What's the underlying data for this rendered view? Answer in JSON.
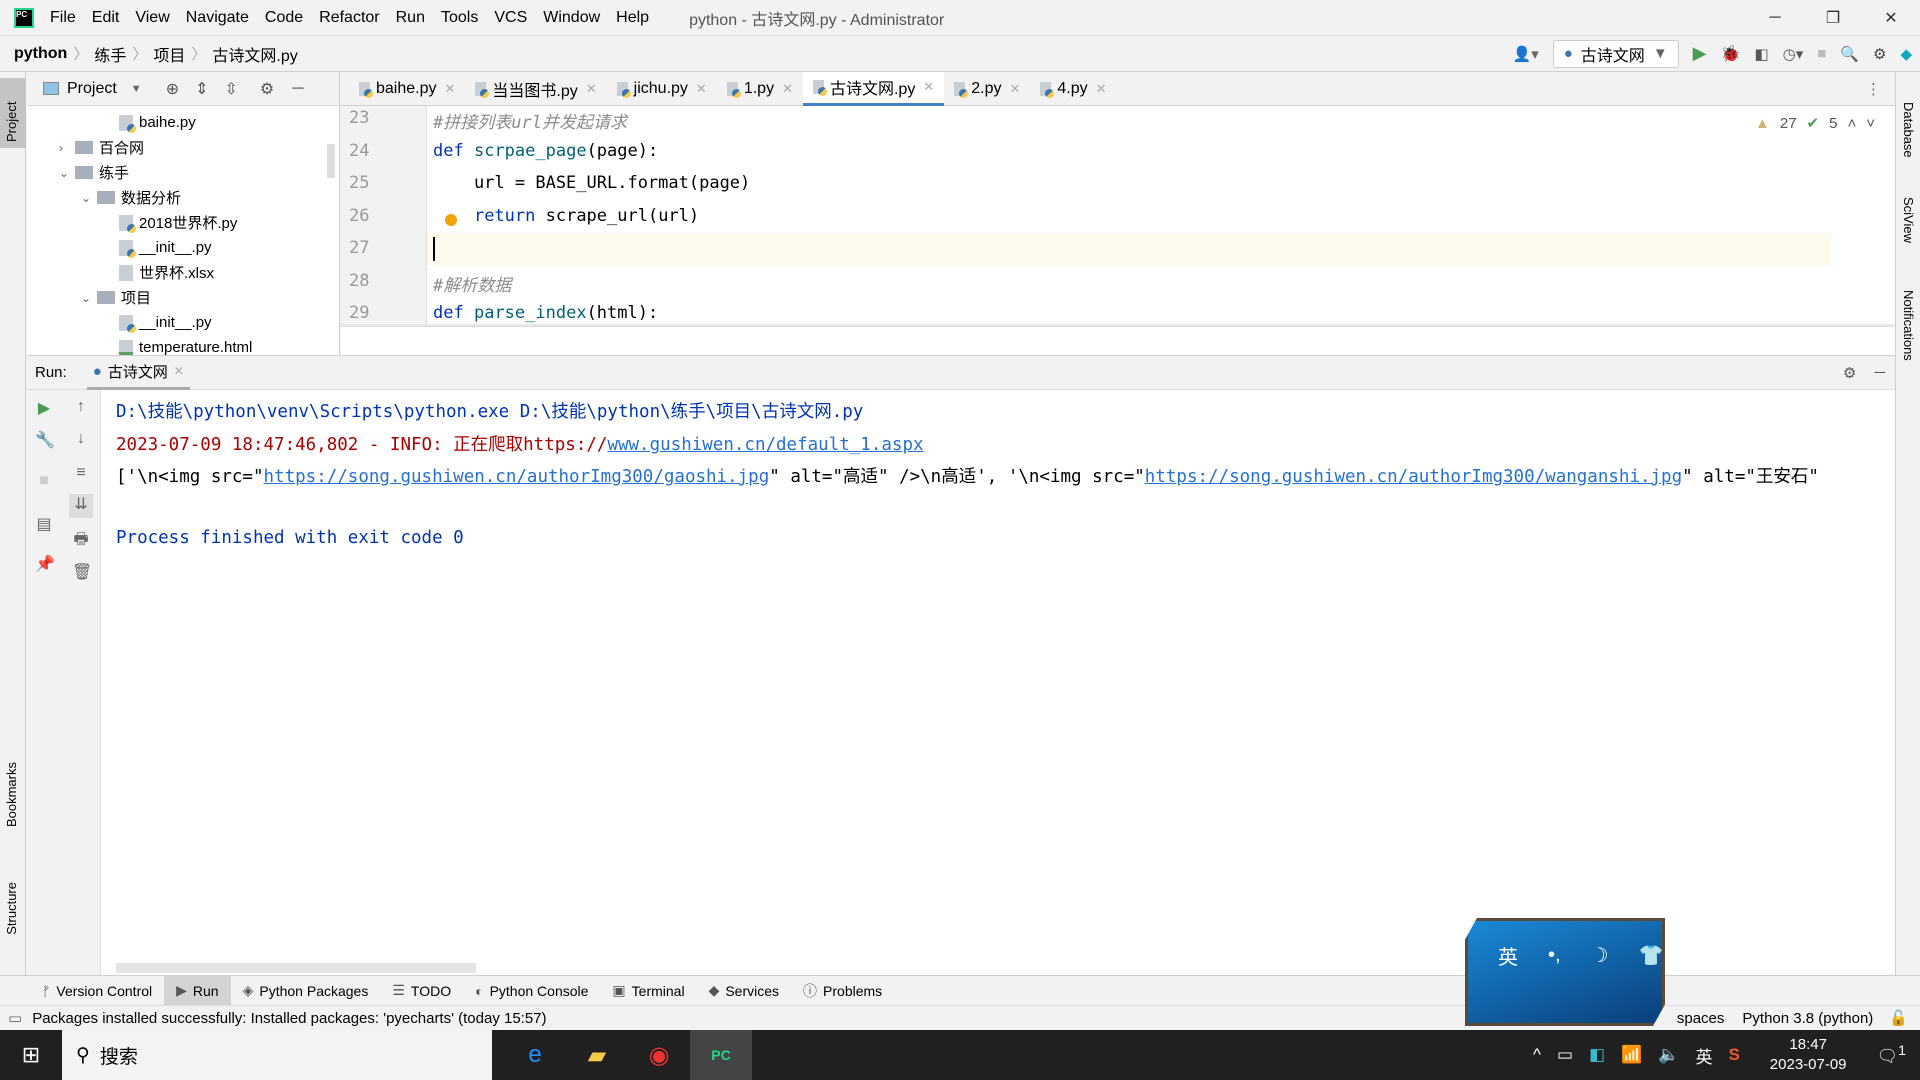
{
  "titlebar": {
    "menu": [
      "File",
      "Edit",
      "View",
      "Navigate",
      "Code",
      "Refactor",
      "Run",
      "Tools",
      "VCS",
      "Window",
      "Help"
    ],
    "title": "python - 古诗文网.py - Administrator"
  },
  "breadcrumb": [
    "python",
    "练手",
    "项目",
    "古诗文网.py"
  ],
  "run_config": "古诗文网",
  "project": {
    "header": "Project",
    "items": [
      {
        "label": "baihe.py",
        "type": "py",
        "depth": 3
      },
      {
        "label": "百合网",
        "type": "folder",
        "depth": 1,
        "expanded": false
      },
      {
        "label": "练手",
        "type": "folder",
        "depth": 1,
        "expanded": true
      },
      {
        "label": "数据分析",
        "type": "package",
        "depth": 2,
        "expanded": true
      },
      {
        "label": "2018世界杯.py",
        "type": "py",
        "depth": 3
      },
      {
        "label": "__init__.py",
        "type": "py",
        "depth": 3
      },
      {
        "label": "世界杯.xlsx",
        "type": "unknown",
        "depth": 3
      },
      {
        "label": "项目",
        "type": "package",
        "depth": 2,
        "expanded": true
      },
      {
        "label": "__init__.py",
        "type": "py",
        "depth": 3
      },
      {
        "label": "temperature.html",
        "type": "html",
        "depth": 3
      }
    ]
  },
  "tabs": [
    {
      "label": "baihe.py"
    },
    {
      "label": "当当图书.py"
    },
    {
      "label": "jichu.py"
    },
    {
      "label": "1.py"
    },
    {
      "label": "古诗文网.py",
      "active": true
    },
    {
      "label": "2.py"
    },
    {
      "label": "4.py"
    }
  ],
  "editor": {
    "warnings": "27",
    "ok": "5",
    "lines": [
      {
        "n": "23",
        "html": "<span class='cm'>#拼接列表url并发起请求</span>"
      },
      {
        "n": "24",
        "html": "<span class='kw'>def</span> <span class='fn'>scrpae_page</span>(page):"
      },
      {
        "n": "25",
        "html": "    url = BASE_URL.format(page)"
      },
      {
        "n": "26",
        "html": "    <span class='kw'>return</span> scrape_url(url)"
      },
      {
        "n": "27",
        "html": ""
      },
      {
        "n": "28",
        "html": "<span class='cm'>#解析数据</span>"
      },
      {
        "n": "29",
        "html": "<span class='kw'>def</span> <span class='fn'>parse_index</span>(html):"
      }
    ]
  },
  "run": {
    "label": "Run:",
    "tab": "古诗文网",
    "cmd": "D:\\技能\\python\\venv\\Scripts\\python.exe D:\\技能\\python\\练手\\项目\\古诗文网.py",
    "info_prefix": "2023-07-09 18:47:46,802 - INFO: 正在爬取https://",
    "info_link": "www.gushiwen.cn/default_1.aspx",
    "out1": "['\\n<img src=\"",
    "out_link1": "https://song.gushiwen.cn/authorImg300/gaoshi.jpg",
    "out2": "\" alt=\"高适\" />\\n高适', '\\n<img src=\"",
    "out_link2": "https://song.gushiwen.cn/authorImg300/wanganshi.jpg",
    "out3": "\" alt=\"王安石\"",
    "exit": "Process finished with exit code 0"
  },
  "bottom_tabs": [
    "Version Control",
    "Run",
    "Python Packages",
    "TODO",
    "Python Console",
    "Terminal",
    "Services",
    "Problems"
  ],
  "right_stripe": [
    "Database",
    "SciView",
    "Notifications"
  ],
  "left_stripe": [
    "Project",
    "Bookmarks",
    "Structure"
  ],
  "status": {
    "message": "Packages installed successfully: Installed packages: 'pyecharts' (today 15:57)",
    "indent": "spaces",
    "interpreter": "Python 3.8 (python)"
  },
  "taskbar": {
    "search": "搜索",
    "ime": "英",
    "time": "18:47",
    "date": "2023-07-09",
    "notif": "1"
  },
  "ime_skin": {
    "mode": "英"
  }
}
